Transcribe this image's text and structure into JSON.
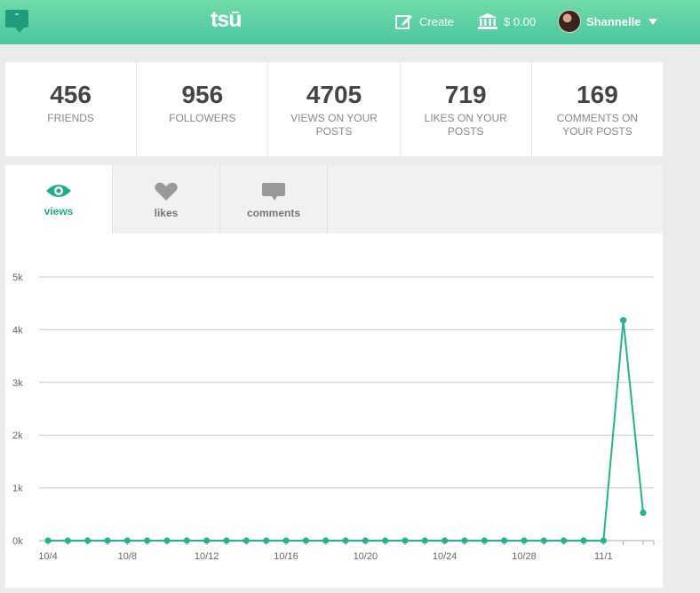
{
  "header": {
    "logo": "tsū",
    "create_label": "Create",
    "balance": "$ 0.00",
    "username": "Shannelle",
    "icons": [
      "chat-icon",
      "pencil-icon",
      "bank-icon",
      "avatar",
      "chevron-down-icon"
    ],
    "accent": "#4cc79f"
  },
  "stats": [
    {
      "value": "456",
      "label": "FRIENDS"
    },
    {
      "value": "956",
      "label": "FOLLOWERS"
    },
    {
      "value": "4705",
      "label": "VIEWS ON YOUR POSTS"
    },
    {
      "value": "719",
      "label": "LIKES ON YOUR POSTS"
    },
    {
      "value": "169",
      "label": "COMMENTS ON YOUR POSTS"
    }
  ],
  "tabs": [
    {
      "label": "views",
      "icon": "eye-icon",
      "active": true
    },
    {
      "label": "likes",
      "icon": "heart-icon",
      "active": false
    },
    {
      "label": "comments",
      "icon": "comment-icon",
      "active": false
    }
  ],
  "chart_data": {
    "type": "line",
    "color": "#22b48f",
    "x": [
      "10/4",
      "10/5",
      "10/6",
      "10/7",
      "10/8",
      "10/9",
      "10/10",
      "10/11",
      "10/12",
      "10/13",
      "10/14",
      "10/15",
      "10/16",
      "10/17",
      "10/18",
      "10/19",
      "10/20",
      "10/21",
      "10/22",
      "10/23",
      "10/24",
      "10/25",
      "10/26",
      "10/27",
      "10/28",
      "10/29",
      "10/30",
      "10/31",
      "11/1",
      "11/2",
      "11/3"
    ],
    "values": [
      0,
      0,
      0,
      0,
      0,
      0,
      0,
      0,
      0,
      0,
      0,
      0,
      0,
      0,
      0,
      0,
      0,
      0,
      0,
      0,
      0,
      0,
      0,
      0,
      0,
      0,
      0,
      0,
      0,
      4180,
      530
    ],
    "x_tick_labels": [
      "10/4",
      "10/8",
      "10/12",
      "10/16",
      "10/20",
      "10/24",
      "10/28",
      "11/1"
    ],
    "y_tick_labels": [
      "0k",
      "1k",
      "2k",
      "3k",
      "4k",
      "5k"
    ],
    "ylim": [
      0,
      5000
    ],
    "grid": true
  }
}
